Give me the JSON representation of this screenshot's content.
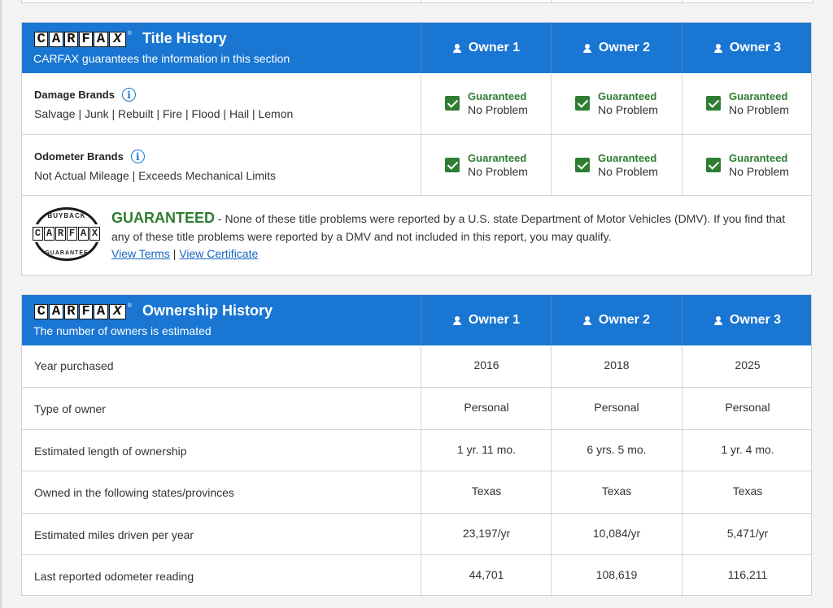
{
  "title_history": {
    "logo_letters": [
      "C",
      "A",
      "R",
      "F",
      "A",
      "X"
    ],
    "title": "Title History",
    "subtitle": "CARFAX guarantees the information in this section",
    "owners": [
      "Owner 1",
      "Owner 2",
      "Owner 3"
    ],
    "rows": [
      {
        "label": "Damage Brands",
        "detail": "Salvage | Junk | Rebuilt | Fire | Flood | Hail | Lemon",
        "status": [
          {
            "guaranteed": "Guaranteed",
            "result": "No Problem"
          },
          {
            "guaranteed": "Guaranteed",
            "result": "No Problem"
          },
          {
            "guaranteed": "Guaranteed",
            "result": "No Problem"
          }
        ]
      },
      {
        "label": "Odometer Brands",
        "detail": "Not Actual Mileage | Exceeds Mechanical Limits",
        "status": [
          {
            "guaranteed": "Guaranteed",
            "result": "No Problem"
          },
          {
            "guaranteed": "Guaranteed",
            "result": "No Problem"
          },
          {
            "guaranteed": "Guaranteed",
            "result": "No Problem"
          }
        ]
      }
    ],
    "guarantee": {
      "seal_top": "BUYBACK",
      "seal_bottom": "GUARANTEE",
      "headline": "GUARANTEED",
      "text": " - None of these title problems were reported by a U.S. state Department of Motor Vehicles (DMV). If you find that any of these title problems were reported by a DMV and not included in this report, you may qualify.",
      "link_terms": "View Terms",
      "separator": " | ",
      "link_certificate": "View Certificate"
    }
  },
  "ownership_history": {
    "title": "Ownership History",
    "subtitle": "The number of owners is estimated",
    "owners": [
      "Owner 1",
      "Owner 2",
      "Owner 3"
    ],
    "rows": [
      {
        "label": "Year purchased",
        "values": [
          "2016",
          "2018",
          "2025"
        ]
      },
      {
        "label": "Type of owner",
        "values": [
          "Personal",
          "Personal",
          "Personal"
        ]
      },
      {
        "label": "Estimated length of ownership",
        "values": [
          "1 yr. 11 mo.",
          "6 yrs. 5 mo.",
          "1 yr. 4 mo."
        ]
      },
      {
        "label": "Owned in the following states/provinces",
        "values": [
          "Texas",
          "Texas",
          "Texas"
        ]
      },
      {
        "label": "Estimated miles driven per year",
        "values": [
          "23,197/yr",
          "10,084/yr",
          "5,471/yr"
        ]
      },
      {
        "label": "Last reported odometer reading",
        "values": [
          "44,701",
          "108,619",
          "116,211"
        ]
      }
    ]
  },
  "colors": {
    "header_blue": "#1976d2",
    "guaranteed_green": "#2e7d32",
    "link_blue": "#1565c0"
  },
  "icons": [
    "person-icon",
    "info-icon",
    "checkbox-checked-icon",
    "carfax-logo",
    "buyback-guarantee-seal"
  ]
}
